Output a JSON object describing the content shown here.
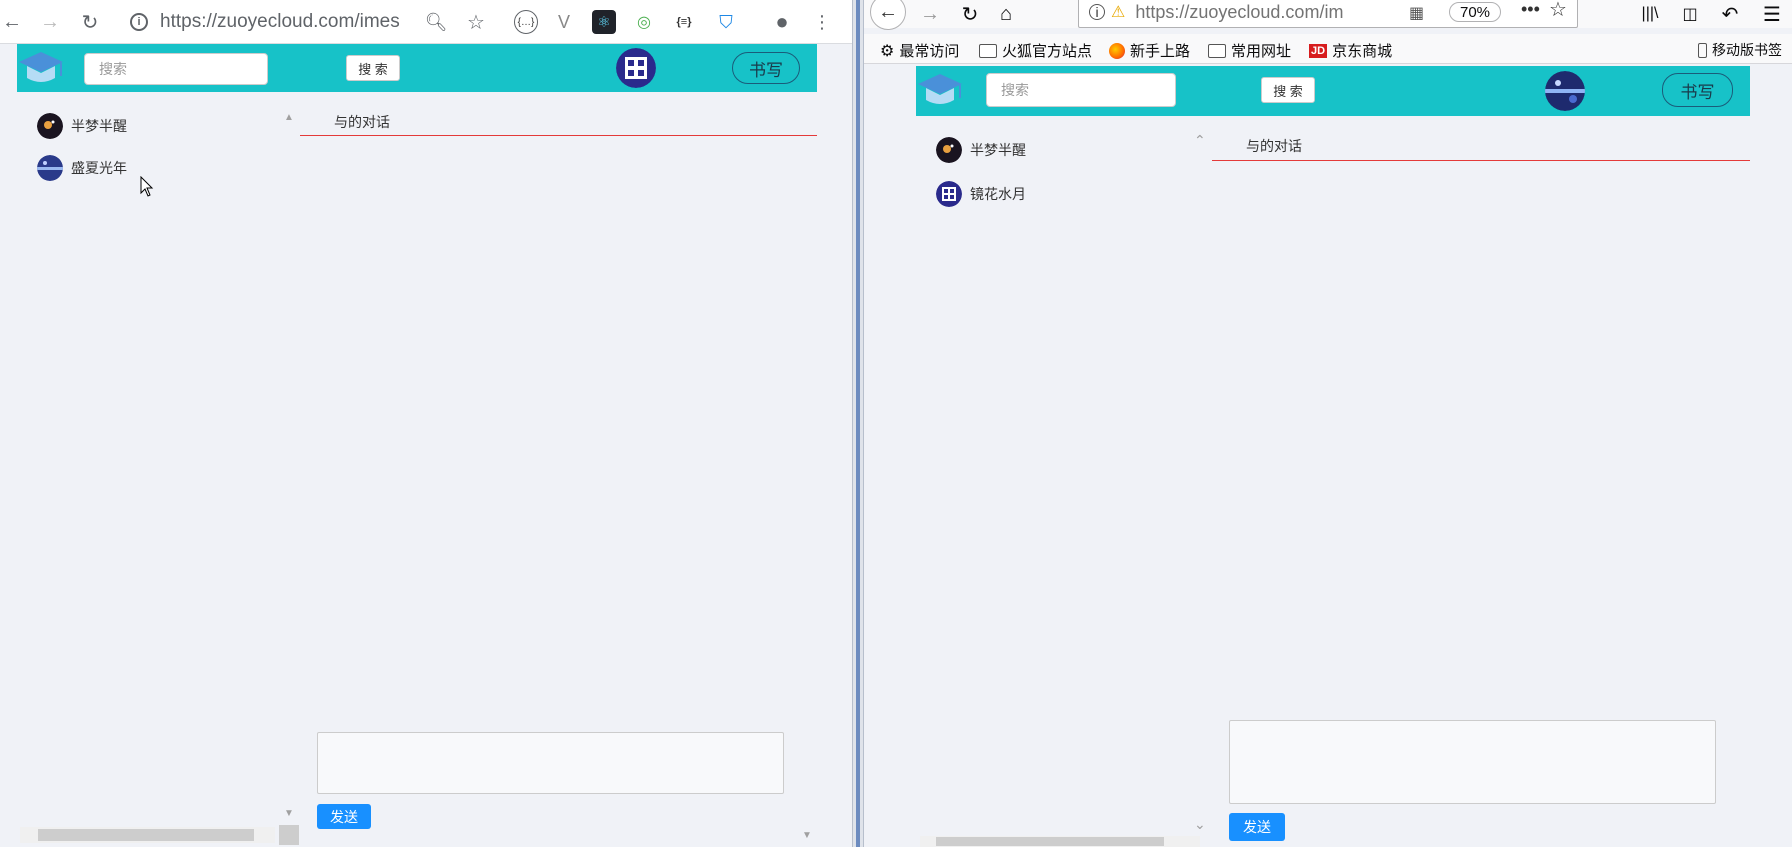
{
  "left_window": {
    "url": "https://zuoyecloud.com/imes",
    "app": {
      "search_placeholder": "搜索",
      "search_button": "搜 索",
      "write_button": "书写"
    },
    "contacts": [
      {
        "name": "半梦半醒"
      },
      {
        "name": "盛夏光年"
      }
    ],
    "chat_title": "与的对话",
    "send_button": "发送"
  },
  "right_window": {
    "url": "https://zuoyecloud.com/im",
    "zoom": "70%",
    "bookmarks": [
      {
        "label": "最常访问",
        "icon": "gear-icon"
      },
      {
        "label": "火狐官方站点",
        "icon": "folder-icon"
      },
      {
        "label": "新手上路",
        "icon": "firefox-icon"
      },
      {
        "label": "常用网址",
        "icon": "folder-icon"
      },
      {
        "label": "京东商城",
        "icon": "jd-icon"
      },
      {
        "label": "移动版书签",
        "icon": "mobile-icon"
      }
    ],
    "app": {
      "search_placeholder": "搜索",
      "search_button": "搜 索",
      "write_button": "书写"
    },
    "contacts": [
      {
        "name": "半梦半醒"
      },
      {
        "name": "镜花水月"
      }
    ],
    "chat_title": "与的对话",
    "send_button": "发送"
  },
  "colors": {
    "header_teal": "#17c2c8",
    "send_blue": "#1890ff",
    "chat_divider_red": "#e43a3a",
    "page_bg": "#f0f2f7"
  }
}
